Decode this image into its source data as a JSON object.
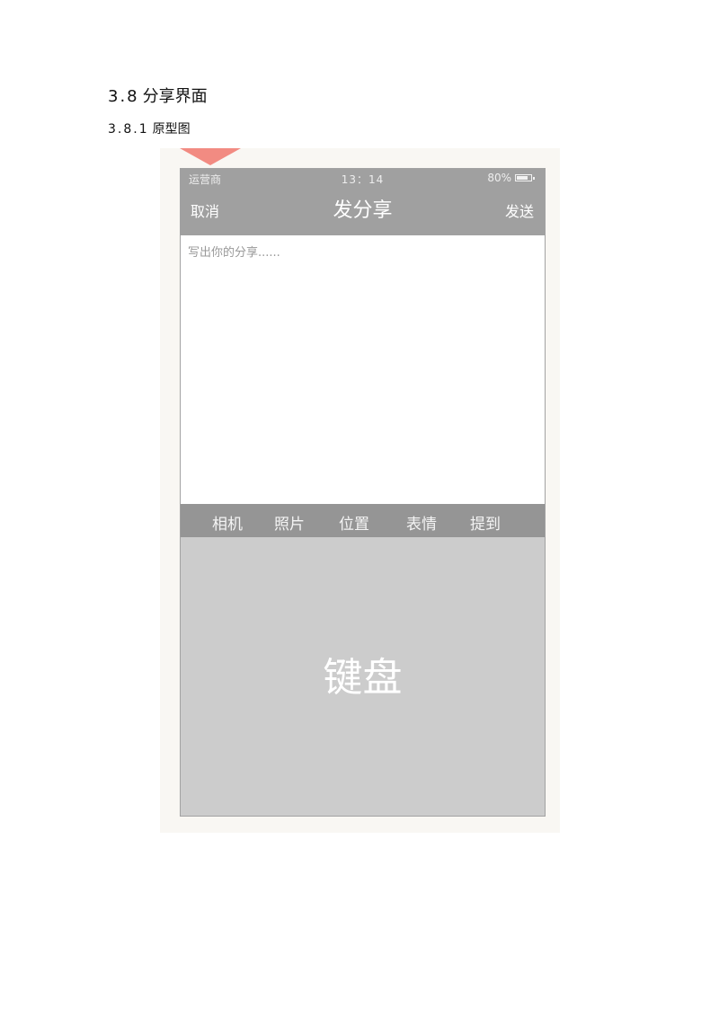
{
  "document": {
    "section_number": "3.8",
    "section_title": "分享界面",
    "subsection_number": "3.8.1",
    "subsection_title": "原型图"
  },
  "phone": {
    "status_bar": {
      "carrier": "运营商",
      "time": "13：14",
      "battery": "80%"
    },
    "nav": {
      "cancel_label": "取消",
      "title": "发分享",
      "send_label": "发送"
    },
    "compose": {
      "placeholder": "写出你的分享......",
      "value": ""
    },
    "toolbar": {
      "items": [
        "相机",
        "照片",
        "位置",
        "表情",
        "提到"
      ]
    },
    "keyboard": {
      "label": "键盘"
    }
  },
  "colors": {
    "topbar": "#a0a0a0",
    "toolbar": "#959595",
    "keyboard": "#cccccc",
    "figure_background": "#f9f7f3",
    "marker": "#f28b82"
  }
}
